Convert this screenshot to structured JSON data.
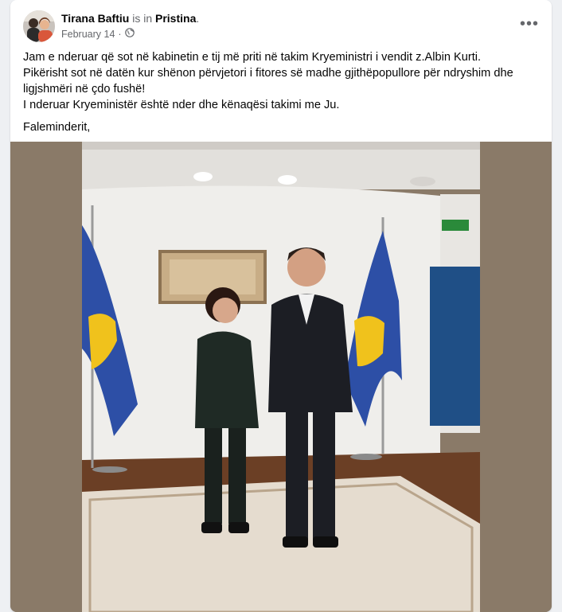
{
  "post": {
    "author": "Tirana Baftiu",
    "is_in": "is in",
    "place": "Pristina",
    "place_suffix": ".",
    "date": "February 14",
    "date_separator": "·",
    "privacy_icon": "globe-icon",
    "more_label": "•••",
    "lines": [
      "Jam e nderuar që sot në kabinetin e tij më priti në takim Kryeministri i vendit z.Albin Kurti.",
      "Pikërisht sot në datën kur shënon përvjetori i fitores së madhe gjithëpopullore për ndryshim dhe",
      "ligjshmëri në çdo fushë!",
      "I nderuar Kryeministër është nder dhe kënaqësi takimi me Ju."
    ],
    "closing": "Faleminderit,"
  },
  "colors": {
    "page_bg": "#eef0f3",
    "card_bg": "#ffffff",
    "secondary_text": "#65676b",
    "photo_border": "#8a7a68"
  }
}
